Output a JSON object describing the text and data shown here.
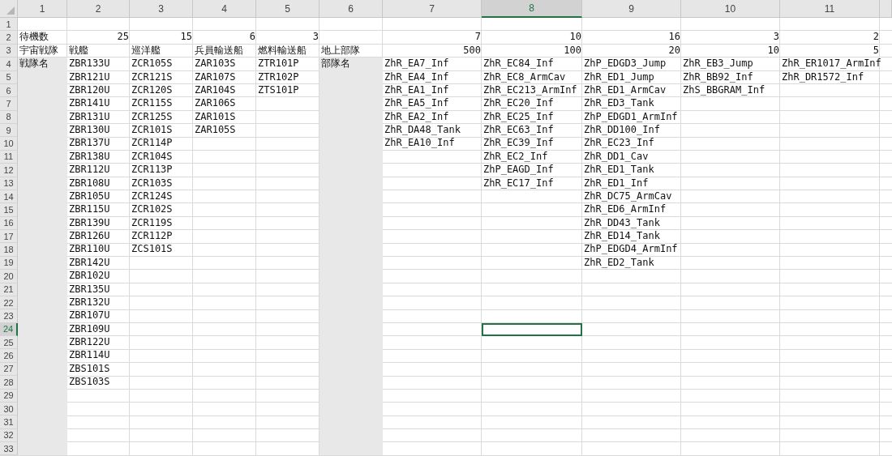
{
  "columns": [
    {
      "header": "1",
      "selected": false,
      "shaded": true
    },
    {
      "header": "2",
      "selected": false,
      "shaded": false
    },
    {
      "header": "3",
      "selected": false,
      "shaded": false
    },
    {
      "header": "4",
      "selected": false,
      "shaded": false
    },
    {
      "header": "5",
      "selected": false,
      "shaded": false
    },
    {
      "header": "6",
      "selected": false,
      "shaded": true
    },
    {
      "header": "7",
      "selected": false,
      "shaded": false
    },
    {
      "header": "8",
      "selected": true,
      "shaded": false
    },
    {
      "header": "9",
      "selected": false,
      "shaded": false
    },
    {
      "header": "10",
      "selected": false,
      "shaded": false
    },
    {
      "header": "11",
      "selected": false,
      "shaded": false
    }
  ],
  "rows": [
    {
      "header": "1",
      "selected": false,
      "shaded_zone": false,
      "cells": []
    },
    {
      "header": "2",
      "selected": false,
      "shaded_zone": false,
      "cells": [
        "待機数",
        {
          "text": "25",
          "kind": "number"
        },
        {
          "text": "15",
          "kind": "number"
        },
        {
          "text": "6",
          "kind": "number"
        },
        {
          "text": "3",
          "kind": "number"
        },
        null,
        {
          "text": "7",
          "kind": "number"
        },
        {
          "text": "10",
          "kind": "number"
        },
        {
          "text": "16",
          "kind": "number"
        },
        {
          "text": "3",
          "kind": "number"
        },
        {
          "text": "2",
          "kind": "number"
        }
      ]
    },
    {
      "header": "3",
      "selected": false,
      "shaded_zone": false,
      "cells": [
        "宇宙戦隊",
        "戦艦",
        "巡洋艦",
        "兵員輸送船",
        "燃料輸送船",
        "地上部隊",
        {
          "text": "500",
          "kind": "number"
        },
        {
          "text": "100",
          "kind": "number"
        },
        {
          "text": "20",
          "kind": "number"
        },
        {
          "text": "10",
          "kind": "number"
        },
        {
          "text": "5",
          "kind": "number"
        }
      ]
    },
    {
      "header": "4",
      "selected": false,
      "shaded_zone": true,
      "cells": [
        "戦隊名",
        "ZBR133U",
        "ZCR105S",
        "ZAR103S",
        "ZTR101P",
        "部隊名",
        "ZhR_EA7_Inf",
        "ZhR_EC84_Inf",
        "ZhP_EDGD3_Jump",
        "ZhR_EB3_Jump",
        "ZhR_ER1017_ArmInf"
      ]
    },
    {
      "header": "5",
      "selected": false,
      "shaded_zone": true,
      "cells": [
        null,
        "ZBR121U",
        "ZCR121S",
        "ZAR107S",
        "ZTR102P",
        null,
        "ZhR_EA4_Inf",
        "ZhR_EC8_ArmCav",
        "ZhR_ED1_Jump",
        "ZhR_BB92_Inf",
        "ZhR_DR1572_Inf"
      ]
    },
    {
      "header": "6",
      "selected": false,
      "shaded_zone": true,
      "cells": [
        null,
        "ZBR120U",
        "ZCR120S",
        "ZAR104S",
        "ZTS101P",
        null,
        "ZhR_EA1_Inf",
        "ZhR_EC213_ArmInf",
        "ZhR_ED1_ArmCav",
        "ZhS_BBGRAM_Inf"
      ]
    },
    {
      "header": "7",
      "selected": false,
      "shaded_zone": true,
      "cells": [
        null,
        "ZBR141U",
        "ZCR115S",
        "ZAR106S",
        null,
        null,
        "ZhR_EA5_Inf",
        "ZhR_EC20_Inf",
        "ZhR_ED3_Tank"
      ]
    },
    {
      "header": "8",
      "selected": false,
      "shaded_zone": true,
      "cells": [
        null,
        "ZBR131U",
        "ZCR125S",
        "ZAR101S",
        null,
        null,
        "ZhR_EA2_Inf",
        "ZhR_EC25_Inf",
        "ZhP_EDGD1_ArmInf"
      ]
    },
    {
      "header": "9",
      "selected": false,
      "shaded_zone": true,
      "cells": [
        null,
        "ZBR130U",
        "ZCR101S",
        "ZAR105S",
        null,
        null,
        "ZhR_DA48_Tank",
        "ZhR_EC63_Inf",
        "ZhR_DD100_Inf"
      ]
    },
    {
      "header": "10",
      "selected": false,
      "shaded_zone": true,
      "cells": [
        null,
        "ZBR137U",
        "ZCR114P",
        null,
        null,
        null,
        "ZhR_EA10_Inf",
        "ZhR_EC39_Inf",
        "ZhR_EC23_Inf"
      ]
    },
    {
      "header": "11",
      "selected": false,
      "shaded_zone": true,
      "cells": [
        null,
        "ZBR138U",
        "ZCR104S",
        null,
        null,
        null,
        null,
        "ZhR_EC2_Inf",
        "ZhR_DD1_Cav"
      ]
    },
    {
      "header": "12",
      "selected": false,
      "shaded_zone": true,
      "cells": [
        null,
        "ZBR112U",
        "ZCR113P",
        null,
        null,
        null,
        null,
        "ZhP_EAGD_Inf",
        "ZhR_ED1_Tank"
      ]
    },
    {
      "header": "13",
      "selected": false,
      "shaded_zone": true,
      "cells": [
        null,
        "ZBR108U",
        "ZCR103S",
        null,
        null,
        null,
        null,
        "ZhR_EC17_Inf",
        "ZhR_ED1_Inf"
      ]
    },
    {
      "header": "14",
      "selected": false,
      "shaded_zone": true,
      "cells": [
        null,
        "ZBR105U",
        "ZCR124S",
        null,
        null,
        null,
        null,
        null,
        "ZhR_DC75_ArmCav"
      ]
    },
    {
      "header": "15",
      "selected": false,
      "shaded_zone": true,
      "cells": [
        null,
        "ZBR115U",
        "ZCR102S",
        null,
        null,
        null,
        null,
        null,
        "ZhR_ED6_ArmInf"
      ]
    },
    {
      "header": "16",
      "selected": false,
      "shaded_zone": true,
      "cells": [
        null,
        "ZBR139U",
        "ZCR119S",
        null,
        null,
        null,
        null,
        null,
        "ZhR_DD43_Tank"
      ]
    },
    {
      "header": "17",
      "selected": false,
      "shaded_zone": true,
      "cells": [
        null,
        "ZBR126U",
        "ZCR112P",
        null,
        null,
        null,
        null,
        null,
        "ZhR_ED14_Tank"
      ]
    },
    {
      "header": "18",
      "selected": false,
      "shaded_zone": true,
      "cells": [
        null,
        "ZBR110U",
        "ZCS101S",
        null,
        null,
        null,
        null,
        null,
        "ZhP_EDGD4_ArmInf"
      ]
    },
    {
      "header": "19",
      "selected": false,
      "shaded_zone": true,
      "cells": [
        null,
        "ZBR142U",
        null,
        null,
        null,
        null,
        null,
        null,
        "ZhR_ED2_Tank"
      ]
    },
    {
      "header": "20",
      "selected": false,
      "shaded_zone": true,
      "cells": [
        null,
        "ZBR102U"
      ]
    },
    {
      "header": "21",
      "selected": false,
      "shaded_zone": true,
      "cells": [
        null,
        "ZBR135U"
      ]
    },
    {
      "header": "22",
      "selected": false,
      "shaded_zone": true,
      "cells": [
        null,
        "ZBR132U"
      ]
    },
    {
      "header": "23",
      "selected": false,
      "shaded_zone": true,
      "cells": [
        null,
        "ZBR107U"
      ]
    },
    {
      "header": "24",
      "selected": true,
      "shaded_zone": true,
      "cells": [
        null,
        "ZBR109U"
      ]
    },
    {
      "header": "25",
      "selected": false,
      "shaded_zone": true,
      "cells": [
        null,
        "ZBR122U"
      ]
    },
    {
      "header": "26",
      "selected": false,
      "shaded_zone": true,
      "cells": [
        null,
        "ZBR114U"
      ]
    },
    {
      "header": "27",
      "selected": false,
      "shaded_zone": true,
      "cells": [
        null,
        "ZBS101S"
      ]
    },
    {
      "header": "28",
      "selected": false,
      "shaded_zone": true,
      "cells": [
        null,
        "ZBS103S"
      ]
    },
    {
      "header": "29",
      "selected": false,
      "shaded_zone": true,
      "cells": []
    },
    {
      "header": "30",
      "selected": false,
      "shaded_zone": true,
      "cells": []
    },
    {
      "header": "31",
      "selected": false,
      "shaded_zone": true,
      "cells": []
    },
    {
      "header": "32",
      "selected": false,
      "shaded_zone": true,
      "cells": []
    },
    {
      "header": "33",
      "selected": false,
      "shaded_zone": true,
      "cells": []
    }
  ]
}
